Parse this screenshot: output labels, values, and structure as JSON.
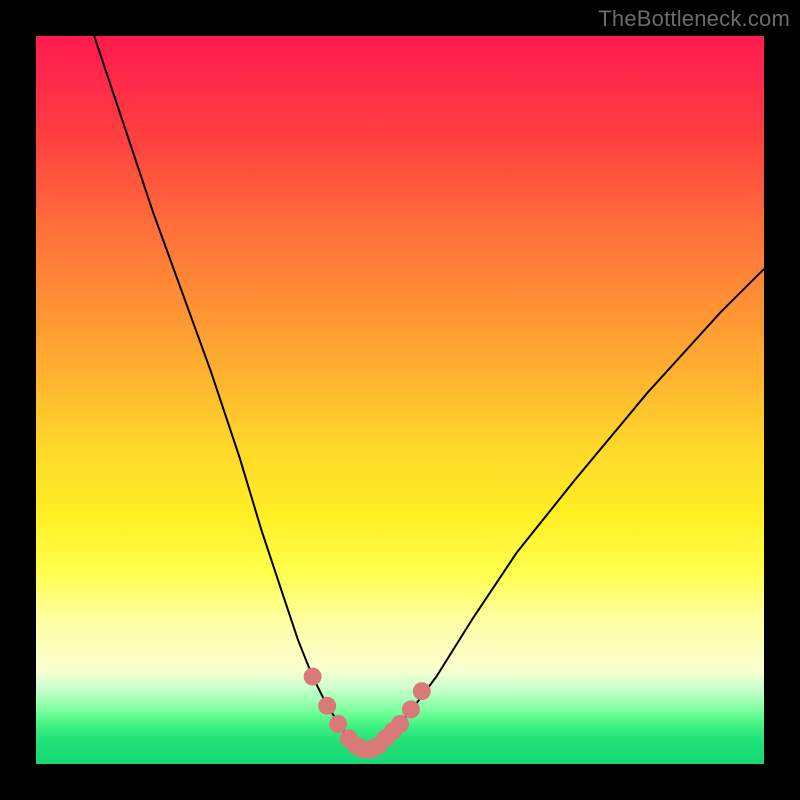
{
  "watermark": "TheBottleneck.com",
  "chart_data": {
    "type": "line",
    "title": "",
    "xlabel": "",
    "ylabel": "",
    "xlim": [
      0,
      100
    ],
    "ylim": [
      0,
      100
    ],
    "series": [
      {
        "name": "curve",
        "x": [
          8,
          12,
          16,
          20,
          24,
          28,
          31,
          34,
          36,
          38,
          40,
          42,
          43,
          44,
          45,
          46,
          47,
          48,
          50,
          52,
          55,
          60,
          66,
          74,
          84,
          94,
          100
        ],
        "y": [
          100,
          88,
          76,
          65,
          54,
          42,
          32,
          23,
          17,
          12,
          8,
          5,
          3.5,
          2.5,
          2,
          2,
          2.5,
          3.5,
          5.5,
          8,
          12,
          20,
          29,
          39,
          51,
          62,
          68
        ]
      }
    ],
    "markers": {
      "name": "dots",
      "color": "#d97a78",
      "points": [
        {
          "x": 38,
          "y": 12
        },
        {
          "x": 40,
          "y": 8
        },
        {
          "x": 41.5,
          "y": 5.5
        },
        {
          "x": 43,
          "y": 3.5
        },
        {
          "x": 44,
          "y": 2.5
        },
        {
          "x": 45,
          "y": 2
        },
        {
          "x": 46,
          "y": 2
        },
        {
          "x": 47,
          "y": 2.5
        },
        {
          "x": 48,
          "y": 3.5
        },
        {
          "x": 49,
          "y": 4.5
        },
        {
          "x": 50,
          "y": 5.5
        },
        {
          "x": 51.5,
          "y": 7.5
        },
        {
          "x": 53,
          "y": 10
        }
      ]
    },
    "colors": {
      "background_top": "#ff1a4d",
      "background_bottom": "#18d872",
      "frame": "#000000",
      "curve": "#000000",
      "marker": "#d97a78"
    }
  }
}
